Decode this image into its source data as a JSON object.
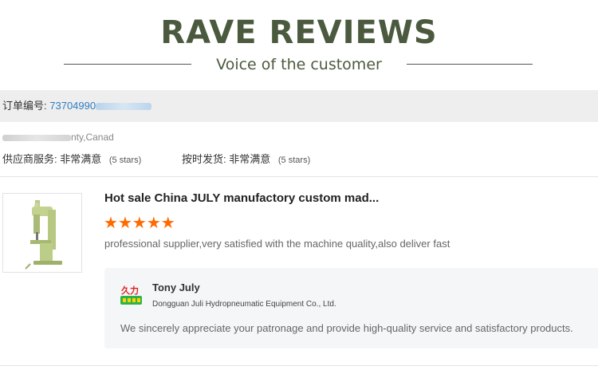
{
  "header": {
    "title": "RAVE REVIEWS",
    "subtitle": "Voice of the customer"
  },
  "order": {
    "label": "订单编号:",
    "number": "73704990"
  },
  "buyer": {
    "location": "nty,Canad"
  },
  "ratings": [
    {
      "label": "供应商服务:",
      "value": "非常满意",
      "stars": "(5 stars)"
    },
    {
      "label": "按时发货:",
      "value": "非常满意",
      "stars": "(5 stars)"
    }
  ],
  "review": {
    "product_title": "Hot sale China JULY manufactory custom mad...",
    "star_count": 5,
    "star_color": "#ff6a00",
    "text": "professional supplier,very satisfied with the machine quality,also deliver fast"
  },
  "reply": {
    "name": "Tony July",
    "company": "Dongguan Juli Hydropneumatic Equipment Co., Ltd.",
    "logo_text": "久力",
    "text": "We sincerely appreciate your patronage and provide high-quality service and satisfactory products."
  },
  "colors": {
    "title": "#4b5a3e",
    "link": "#2f7cc0",
    "accent": "#ff6a00"
  }
}
